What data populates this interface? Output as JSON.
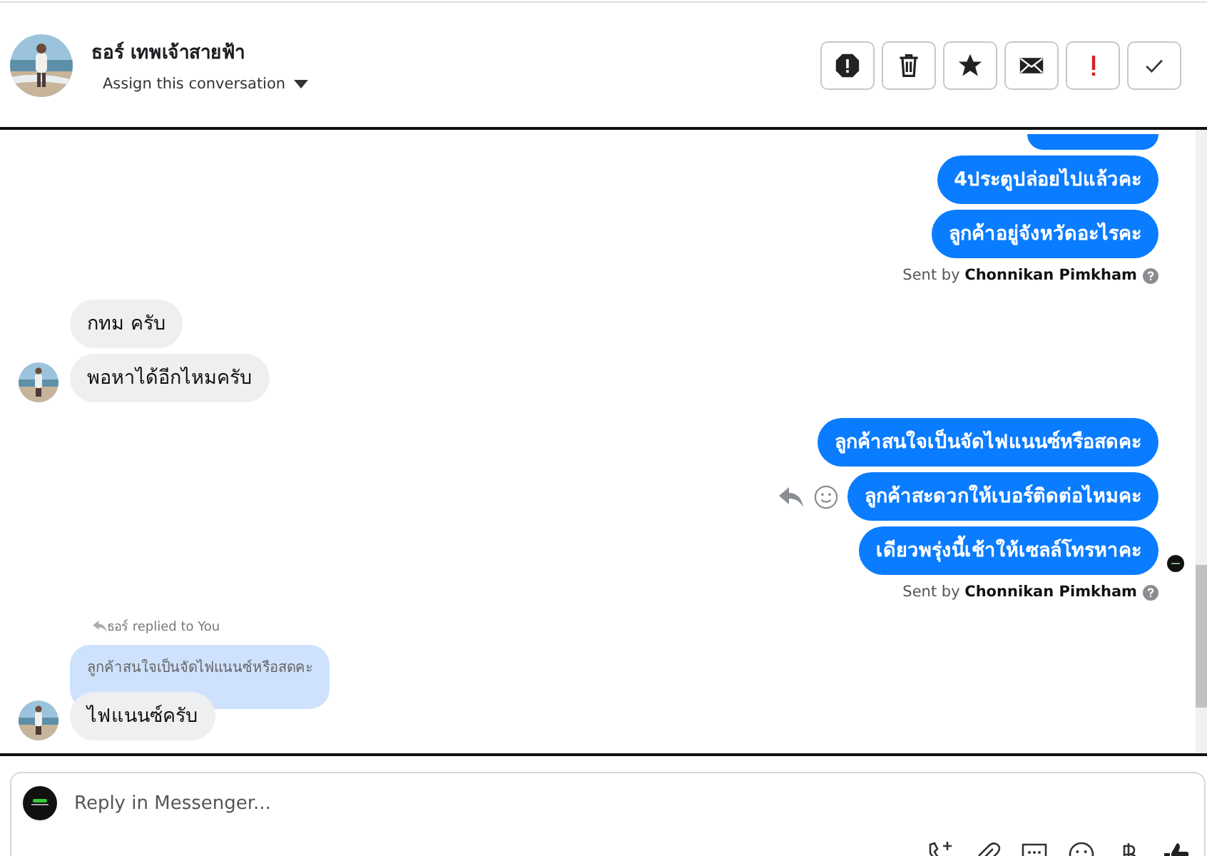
{
  "header": {
    "name": "ธอร์ เทพเจ้าสายฟ้า",
    "assign_label": "Assign this conversation",
    "actions": [
      {
        "kind": "report"
      },
      {
        "kind": "delete"
      },
      {
        "kind": "star"
      },
      {
        "kind": "mail"
      },
      {
        "kind": "urgent"
      },
      {
        "kind": "done"
      }
    ]
  },
  "groups": [
    {
      "kind": "out",
      "cut_above": true,
      "bubbles": [
        {
          "text": "4ประตูปล่อยไปแล้วคะ",
          "actions": false,
          "seen": false
        },
        {
          "text": "ลูกค้าอยู่จังหวัดอะไรคะ",
          "actions": false,
          "seen": false
        }
      ],
      "sent_by": "Sent by",
      "sender": "Chonnikan Pimkham"
    },
    {
      "kind": "in",
      "bubbles": [
        {
          "text": "กทม ครับ"
        },
        {
          "text": "พอหาได้อีกไหมครับ"
        }
      ]
    },
    {
      "kind": "out",
      "cut_above": false,
      "bubbles": [
        {
          "text": "ลูกค้าสนใจเป็นจัดไฟแนนซ์หรือสดคะ",
          "actions": false,
          "seen": false
        },
        {
          "text": "ลูกค้าสะดวกให้เบอร์ติดต่อไหมคะ",
          "actions": true,
          "seen": false
        },
        {
          "text": "เดียวพรุ่งนี้เช้าให้เซลล์โทรหาคะ",
          "actions": false,
          "seen": true
        }
      ],
      "sent_by": "Sent by",
      "sender": "Chonnikan Pimkham"
    },
    {
      "kind": "in",
      "reply_note": "ธอร์ replied to You",
      "quote": "ลูกค้าสนใจเป็นจัดไฟแนนซ์หรือสดคะ",
      "bubbles": [
        {
          "text": "ไฟแนนซ์ครับ"
        }
      ]
    }
  ],
  "composer": {
    "placeholder": "Reply in Messenger...",
    "tools": [
      {
        "kind": "call"
      },
      {
        "kind": "attach"
      },
      {
        "kind": "chat"
      },
      {
        "kind": "emoji"
      },
      {
        "kind": "baht"
      },
      {
        "kind": "like"
      }
    ]
  }
}
